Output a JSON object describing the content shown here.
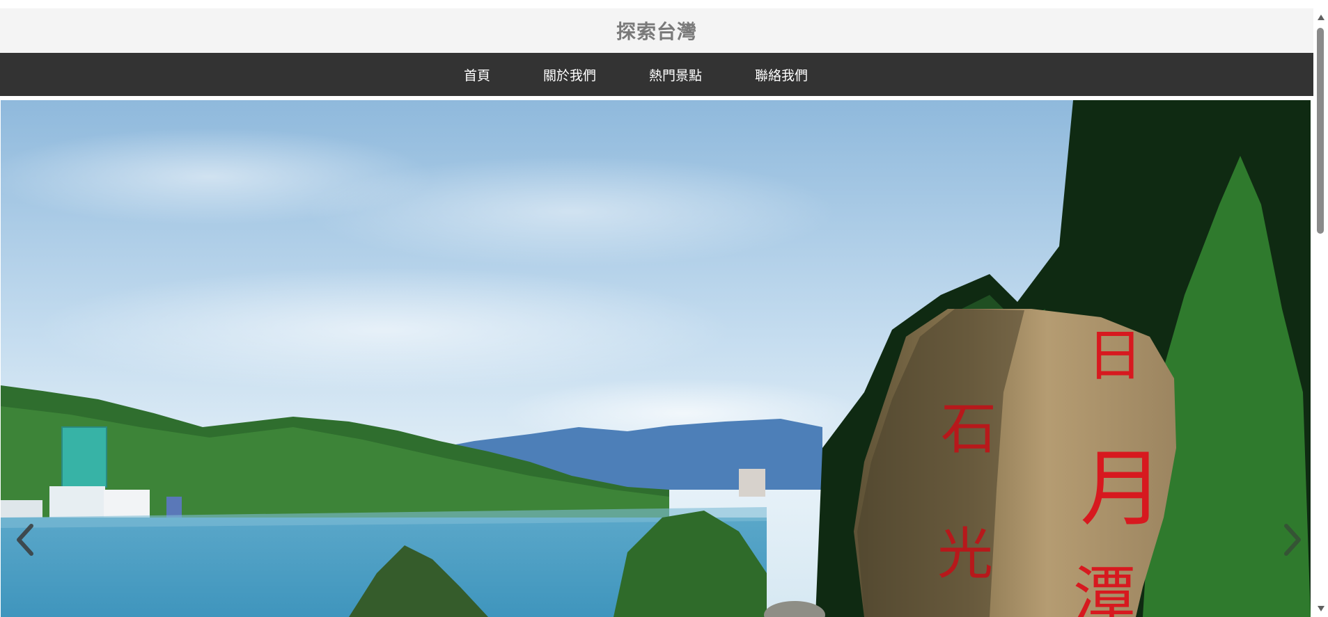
{
  "header": {
    "title": "探索台灣"
  },
  "nav": {
    "items": [
      {
        "label": "首頁"
      },
      {
        "label": "關於我們"
      },
      {
        "label": "熱門景點"
      },
      {
        "label": "聯絡我們"
      }
    ]
  },
  "carousel": {
    "image_subject": "Sun Moon Lake scenic photo with carved stone monument",
    "stone_inscription": "日月潭",
    "prev_icon": "chevron-left-icon",
    "next_icon": "chevron-right-icon"
  },
  "scrollbar": {
    "up_icon": "triangle-up-icon",
    "down_icon": "triangle-down-icon"
  },
  "colors": {
    "header_bg": "#f4f4f4",
    "title_color": "#7a7a7a",
    "navbar_bg": "#333333",
    "nav_text": "#ffffff"
  }
}
